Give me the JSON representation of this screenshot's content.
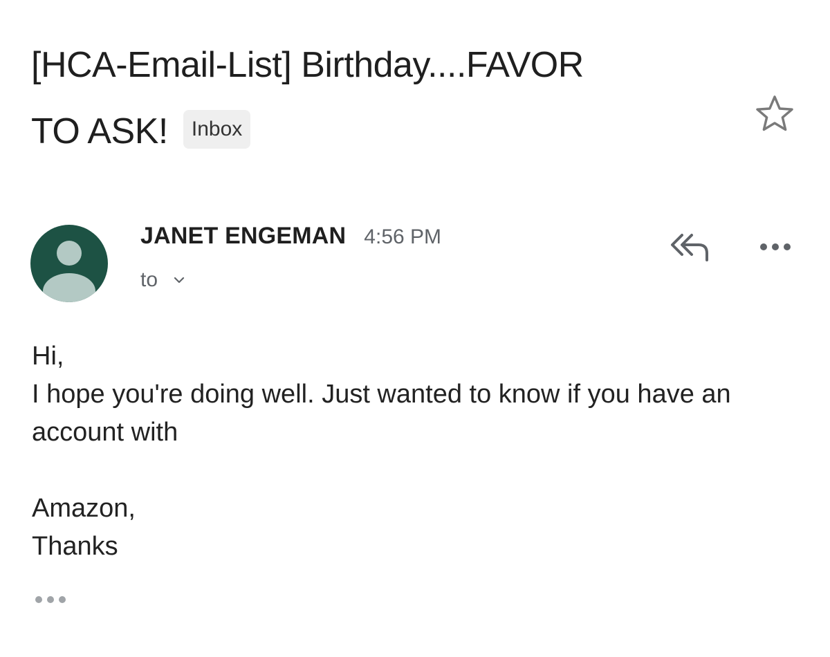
{
  "email": {
    "subject_line1": "[HCA-Email-List] Birthday....FAVOR",
    "subject_line2": "TO ASK!",
    "label": "Inbox",
    "sender_name": "JANET ENGEMAN",
    "time": "4:56 PM",
    "to_label": "to",
    "body": {
      "line1": "Hi,",
      "line2": "I hope you're doing well. Just wanted to know if you have an account with",
      "line3": "Amazon,",
      "line4": "Thanks"
    }
  },
  "icons": {
    "star": "star-icon",
    "reply_all": "reply-all-icon",
    "more": "more-options-icon",
    "chevron": "chevron-down-icon",
    "avatar": "person-avatar-icon",
    "trimmed": "show-trimmed-content-icon"
  },
  "colors": {
    "avatar_bg": "#1d5244",
    "avatar_fg": "#b3c9c4",
    "chip_bg": "#efefef",
    "icon_gray": "#5f6368"
  }
}
